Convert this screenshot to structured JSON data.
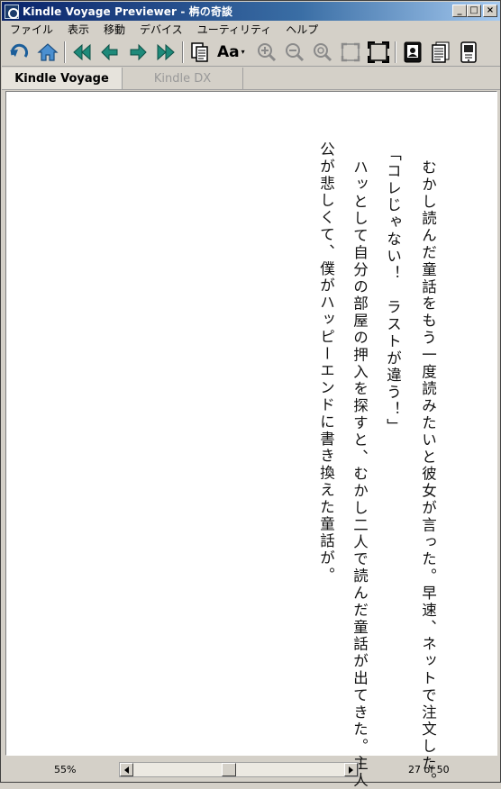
{
  "window": {
    "title": "Kindle Voyage Previewer - 栴の奇談",
    "minimize_glyph": "_",
    "maximize_glyph": "□",
    "close_glyph": "×"
  },
  "menu": [
    "ファイル",
    "表示",
    "移動",
    "デバイス",
    "ユーティリティ",
    "ヘルプ"
  ],
  "toolbar": {
    "font_label": "Aa",
    "font_caret": "▾",
    "icons": [
      "back-icon",
      "home-icon",
      "first-page-icon",
      "prev-page-icon",
      "next-page-icon",
      "last-page-icon",
      "copy-icon",
      "font-size-icon",
      "zoom-in-icon",
      "zoom-out-icon",
      "zoom-reset-icon",
      "fit-page-icon",
      "fullscreen-icon",
      "device-portrait-icon",
      "document-icon",
      "device-settings-icon"
    ]
  },
  "tabs": [
    {
      "label": "Kindle Voyage",
      "active": true
    },
    {
      "label": "Kindle DX",
      "active": false
    }
  ],
  "content": {
    "lines": [
      "むかし読んだ童話をもう一度読みたいと彼女が言った。早速、ネットで注文した。",
      "「コレじゃない！　ラストが違う！」",
      "ハッとして自分の部屋の押入を探すと、むかし二人で読んだ童話が出てきた。主人",
      "公が悲しくて、僕がハッピーエンドに書き換えた童話が。"
    ]
  },
  "status": {
    "zoom": "55%",
    "page": "27 of 50",
    "scroll_position": 0.45
  }
}
